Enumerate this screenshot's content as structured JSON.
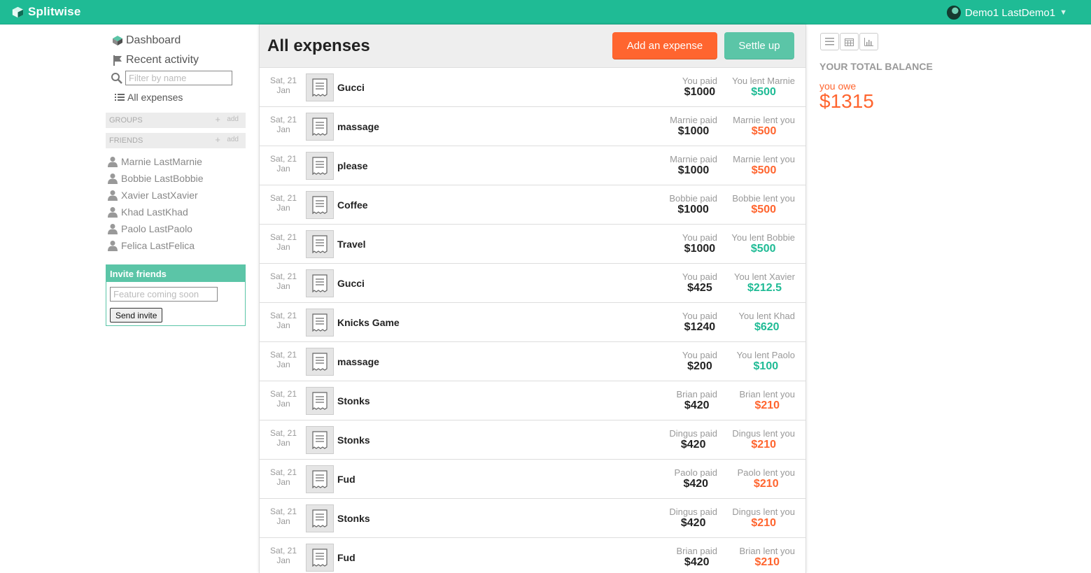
{
  "app": {
    "name": "Splitwise",
    "user": "Demo1 LastDemo1"
  },
  "sidebar": {
    "dashboard": "Dashboard",
    "recent_activity": "Recent activity",
    "filter_placeholder": "Filter by name",
    "all_expenses": "All expenses",
    "groups_label": "GROUPS",
    "friends_label": "FRIENDS",
    "add_label": "add",
    "friends": [
      "Marnie LastMarnie",
      "Bobbie LastBobbie",
      "Xavier LastXavier",
      "Khad LastKhad",
      "Paolo LastPaolo",
      "Felica LastFelica"
    ],
    "invite": {
      "title": "Invite friends",
      "placeholder": "Feature coming soon",
      "button": "Send invite"
    }
  },
  "main": {
    "title": "All expenses",
    "add_button": "Add an expense",
    "settle_button": "Settle up",
    "expenses": [
      {
        "date_day": "Sat, 21",
        "date_month": "Jan",
        "description": "Gucci",
        "payer": "You paid",
        "paid": "$1000",
        "lent_label": "You lent Marnie",
        "lent": "$500",
        "direction": "green"
      },
      {
        "date_day": "Sat, 21",
        "date_month": "Jan",
        "description": "massage",
        "payer": "Marnie paid",
        "paid": "$1000",
        "lent_label": "Marnie lent you",
        "lent": "$500",
        "direction": "orange"
      },
      {
        "date_day": "Sat, 21",
        "date_month": "Jan",
        "description": "please",
        "payer": "Marnie paid",
        "paid": "$1000",
        "lent_label": "Marnie lent you",
        "lent": "$500",
        "direction": "orange"
      },
      {
        "date_day": "Sat, 21",
        "date_month": "Jan",
        "description": "Coffee",
        "payer": "Bobbie paid",
        "paid": "$1000",
        "lent_label": "Bobbie lent you",
        "lent": "$500",
        "direction": "orange"
      },
      {
        "date_day": "Sat, 21",
        "date_month": "Jan",
        "description": "Travel",
        "payer": "You paid",
        "paid": "$1000",
        "lent_label": "You lent Bobbie",
        "lent": "$500",
        "direction": "green"
      },
      {
        "date_day": "Sat, 21",
        "date_month": "Jan",
        "description": "Gucci",
        "payer": "You paid",
        "paid": "$425",
        "lent_label": "You lent Xavier",
        "lent": "$212.5",
        "direction": "green"
      },
      {
        "date_day": "Sat, 21",
        "date_month": "Jan",
        "description": "Knicks Game",
        "payer": "You paid",
        "paid": "$1240",
        "lent_label": "You lent Khad",
        "lent": "$620",
        "direction": "green"
      },
      {
        "date_day": "Sat, 21",
        "date_month": "Jan",
        "description": "massage",
        "payer": "You paid",
        "paid": "$200",
        "lent_label": "You lent Paolo",
        "lent": "$100",
        "direction": "green"
      },
      {
        "date_day": "Sat, 21",
        "date_month": "Jan",
        "description": "Stonks",
        "payer": "Brian paid",
        "paid": "$420",
        "lent_label": "Brian lent you",
        "lent": "$210",
        "direction": "orange"
      },
      {
        "date_day": "Sat, 21",
        "date_month": "Jan",
        "description": "Stonks",
        "payer": "Dingus paid",
        "paid": "$420",
        "lent_label": "Dingus lent you",
        "lent": "$210",
        "direction": "orange"
      },
      {
        "date_day": "Sat, 21",
        "date_month": "Jan",
        "description": "Fud",
        "payer": "Paolo paid",
        "paid": "$420",
        "lent_label": "Paolo lent you",
        "lent": "$210",
        "direction": "orange"
      },
      {
        "date_day": "Sat, 21",
        "date_month": "Jan",
        "description": "Stonks",
        "payer": "Dingus paid",
        "paid": "$420",
        "lent_label": "Dingus lent you",
        "lent": "$210",
        "direction": "orange"
      },
      {
        "date_day": "Sat, 21",
        "date_month": "Jan",
        "description": "Fud",
        "payer": "Brian paid",
        "paid": "$420",
        "lent_label": "Brian lent you",
        "lent": "$210",
        "direction": "orange"
      }
    ]
  },
  "right": {
    "balance_title": "YOUR TOTAL BALANCE",
    "balance_label": "you owe",
    "balance_amount": "$1315"
  },
  "colors": {
    "brand": "#1fbb95",
    "orange": "#ff652f",
    "green": "#1fbb95",
    "teal": "#5bc5a7"
  },
  "icons": [
    "splitwise-logo-icon",
    "dashboard-icon",
    "flag-icon",
    "search-icon",
    "list-icon",
    "person-icon",
    "receipt-icon",
    "list-view-icon",
    "calendar-icon",
    "chart-icon",
    "caret-down-icon"
  ]
}
